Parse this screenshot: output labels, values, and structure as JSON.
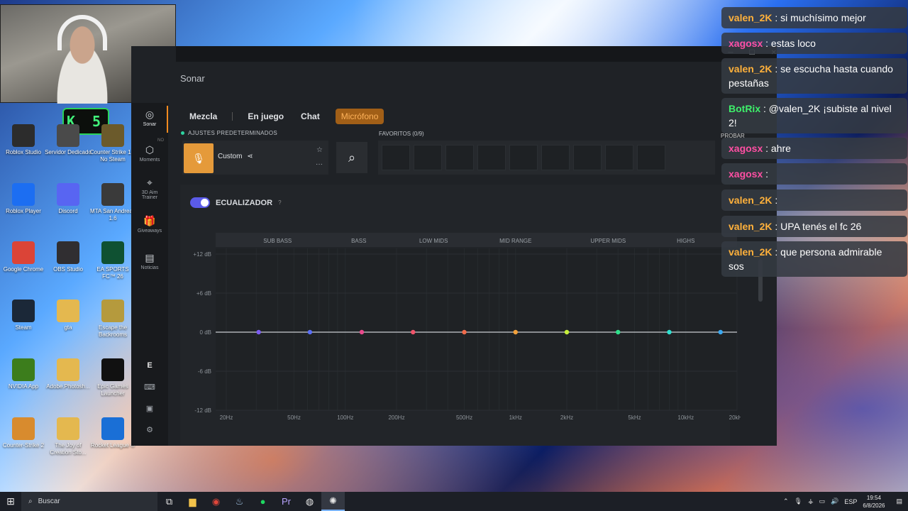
{
  "desktop_icons": [
    {
      "label": "Roblox Studio",
      "icon": "roblox-studio-icon",
      "color": "#2c2c2c"
    },
    {
      "label": "Servidor Dedicado",
      "icon": "server-icon",
      "color": "#4a4a4a"
    },
    {
      "label": "Counter Strike 1.6 No Steam",
      "icon": "cs16-icon",
      "color": "#6b5a2b"
    },
    {
      "label": "Roblox Player",
      "icon": "roblox-player-icon",
      "color": "#1c6ef2"
    },
    {
      "label": "Discord",
      "icon": "discord-icon",
      "color": "#5865f2"
    },
    {
      "label": "MTA San Andreas 1.6",
      "icon": "mta-icon",
      "color": "#3a3a3a"
    },
    {
      "label": "Google Chrome",
      "icon": "chrome-icon",
      "color": "#db4437"
    },
    {
      "label": "OBS Studio",
      "icon": "obs-icon",
      "color": "#302e31"
    },
    {
      "label": "EA SPORTS FC™ 26",
      "icon": "fc26-icon",
      "color": "#0f5132"
    },
    {
      "label": "Steam",
      "icon": "steam-icon",
      "color": "#1b2838"
    },
    {
      "label": "gta",
      "icon": "folder-icon",
      "color": "#e4b84f"
    },
    {
      "label": "Escape the Backrooms",
      "icon": "backrooms-icon",
      "color": "#b59a3d"
    },
    {
      "label": "NVIDIA App",
      "icon": "nvidia-icon",
      "color": "#3c7d1c"
    },
    {
      "label": "Adobe.Photosh...",
      "icon": "folder-icon",
      "color": "#e4b84f"
    },
    {
      "label": "Epic Games Launcher",
      "icon": "epic-icon",
      "color": "#111111"
    },
    {
      "label": "Counter-Strike 2",
      "icon": "cs2-icon",
      "color": "#d88b2e"
    },
    {
      "label": "The Joy of Creation Sto...",
      "icon": "folder-icon",
      "color": "#e4b84f"
    },
    {
      "label": "Rocket League ®",
      "icon": "rocket-league-icon",
      "color": "#1a6fd6"
    }
  ],
  "widget_k5": "K 5",
  "sonar": {
    "app_title": "Sonar",
    "rail": [
      {
        "label": "Sonar",
        "glyph": "◎"
      },
      {
        "label": "Moments",
        "glyph": "⬡",
        "badge": "NO"
      },
      {
        "label": "3D Aim Trainer",
        "glyph": "⌖"
      },
      {
        "label": "Giveaways",
        "glyph": "🎁"
      },
      {
        "label": "Noticias",
        "glyph": "▤"
      }
    ],
    "rail_bottom": [
      "E",
      "⌨",
      "▣",
      "⚙"
    ],
    "tabs": [
      "Mezcla",
      "En juego",
      "Chat",
      "Micrófono"
    ],
    "active_tab": "Micrófono",
    "presets_label": "AJUSTES PREDETERMINADOS",
    "favorites_label": "FAVORITOS (0/9)",
    "preset_name": "Custom",
    "eq_label": "ECUALIZADOR",
    "eq_help": "?",
    "accent": "#f58a1f"
  },
  "chart_data": {
    "type": "line",
    "bands": [
      "SUB BASS",
      "BASS",
      "LOW MIDS",
      "MID RANGE",
      "UPPER MIDS",
      "HIGHS"
    ],
    "y_ticks": [
      "+12 dB",
      "+6 dB",
      "0 dB",
      "-6 dB",
      "-12 dB"
    ],
    "x_ticks": [
      "20Hz",
      "50Hz",
      "100Hz",
      "200Hz",
      "500Hz",
      "1kHz",
      "2kHz",
      "5kHz",
      "10kHz",
      "20kHz"
    ],
    "ylim": [
      -12,
      12
    ],
    "points": [
      {
        "freq": 31,
        "gain": 0,
        "color": "#7c5cf2"
      },
      {
        "freq": 62,
        "gain": 0,
        "color": "#5a6ef5"
      },
      {
        "freq": 125,
        "gain": 0,
        "color": "#e84a8c"
      },
      {
        "freq": 250,
        "gain": 0,
        "color": "#f0546a"
      },
      {
        "freq": 500,
        "gain": 0,
        "color": "#f06a4a"
      },
      {
        "freq": 1000,
        "gain": 0,
        "color": "#f2a03a"
      },
      {
        "freq": 2000,
        "gain": 0,
        "color": "#c6ef3a"
      },
      {
        "freq": 4000,
        "gain": 0,
        "color": "#2ee08a"
      },
      {
        "freq": 8000,
        "gain": 0,
        "color": "#2ee0d0"
      },
      {
        "freq": 16000,
        "gain": 0,
        "color": "#3aa8f0"
      }
    ]
  },
  "chat": {
    "probar_label": "PROBAR",
    "messages": [
      {
        "user": "valen_2K",
        "user_color": "#ffb13b",
        "text": "si muchísimo mejor"
      },
      {
        "user": "xagosx",
        "user_color": "#ff4fa3",
        "text": "estas loco"
      },
      {
        "user": "valen_2K",
        "user_color": "#ffb13b",
        "text": "se escucha hasta cuando pestañas"
      },
      {
        "user": "BotRix",
        "user_color": "#3ef06b",
        "text": "@valen_2K ¡subiste al nivel 2!"
      },
      {
        "user": "xagosx",
        "user_color": "#ff4fa3",
        "text": "ahre"
      },
      {
        "user": "xagosx",
        "user_color": "#ff4fa3",
        "text": ""
      },
      {
        "user": "valen_2K",
        "user_color": "#ffb13b",
        "text": ""
      },
      {
        "user": "valen_2K",
        "user_color": "#ffb13b",
        "text": "UPA tenés el fc 26"
      },
      {
        "user": "valen_2K",
        "user_color": "#ffb13b",
        "text": "que persona admirable sos"
      }
    ]
  },
  "taskbar": {
    "search_placeholder": "Buscar",
    "language": "ESP",
    "time": "19:54",
    "date": "6/8/2026"
  }
}
